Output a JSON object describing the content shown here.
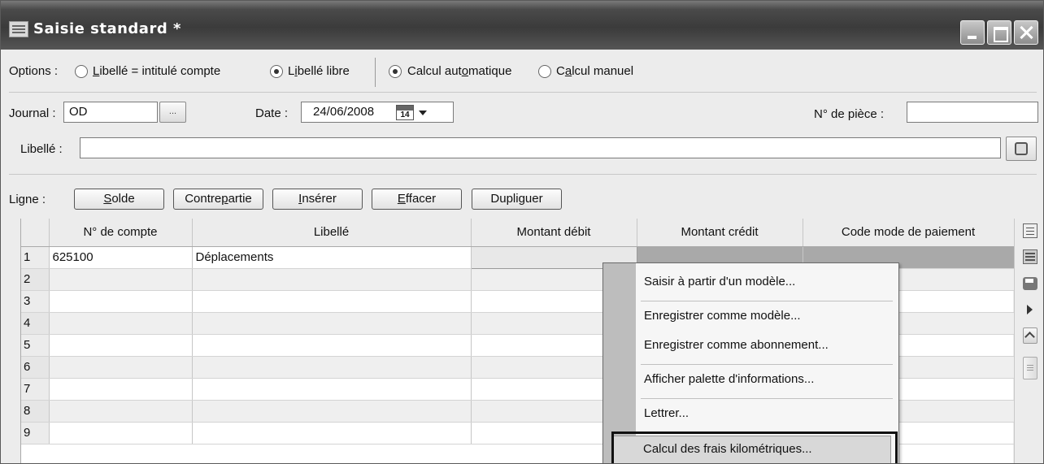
{
  "window": {
    "title": "Saisie standard *"
  },
  "options": {
    "label": "Options :",
    "libelle_intitule_pre": "",
    "libelle_intitule_u": "L",
    "libelle_intitule_post": "ibellé = intitulé compte",
    "libelle_libre_pre": "L",
    "libelle_libre_u": "i",
    "libelle_libre_post": "bellé libre",
    "calcul_auto_pre": "Calcul aut",
    "calcul_auto_u": "o",
    "calcul_auto_post": "matique",
    "calcul_manuel_pre": "C",
    "calcul_manuel_u": "a",
    "calcul_manuel_post": "lcul manuel",
    "selected_libelle": "libre",
    "selected_calcul": "automatique"
  },
  "header": {
    "journal_label": "Journal :",
    "journal_value": "OD",
    "ellipsis": "...",
    "date_label": "Date :",
    "date_value": "24/06/2008",
    "calendar_day": "14",
    "piece_label": "N° de pièce :",
    "piece_value": "",
    "libelle_label": "Libellé :",
    "libelle_value": ""
  },
  "line_bar": {
    "label": "Ligne :",
    "buttons": [
      {
        "pre": "",
        "u": "S",
        "post": "olde"
      },
      {
        "pre": "Contre",
        "u": "p",
        "post": "artie"
      },
      {
        "pre": "",
        "u": "I",
        "post": "nsérer"
      },
      {
        "pre": "",
        "u": "E",
        "post": "ffacer"
      },
      {
        "pre": "Dupli",
        "u": "g",
        "post": "uer"
      }
    ]
  },
  "grid": {
    "columns": [
      "",
      "N° de compte",
      "Libellé",
      "Montant débit",
      "Montant crédit",
      "Code mode de paiement"
    ],
    "rows": [
      {
        "num": "1",
        "compte": "625100",
        "libelle": "Déplacements",
        "debit": "",
        "credit": "",
        "code": ""
      },
      {
        "num": "2",
        "compte": "",
        "libelle": "",
        "debit": "",
        "credit": "",
        "code": ""
      },
      {
        "num": "3",
        "compte": "",
        "libelle": "",
        "debit": "",
        "credit": "",
        "code": ""
      },
      {
        "num": "4",
        "compte": "",
        "libelle": "",
        "debit": "",
        "credit": "",
        "code": ""
      },
      {
        "num": "5",
        "compte": "",
        "libelle": "",
        "debit": "",
        "credit": "",
        "code": ""
      },
      {
        "num": "6",
        "compte": "",
        "libelle": "",
        "debit": "",
        "credit": "",
        "code": ""
      },
      {
        "num": "7",
        "compte": "",
        "libelle": "",
        "debit": "",
        "credit": "",
        "code": ""
      },
      {
        "num": "8",
        "compte": "",
        "libelle": "",
        "debit": "",
        "credit": "",
        "code": ""
      },
      {
        "num": "9",
        "compte": "",
        "libelle": "",
        "debit": "",
        "credit": "",
        "code": ""
      }
    ]
  },
  "side_tools": [
    "sort-icon",
    "list-icon",
    "print-icon",
    "play-icon",
    "scroll-up-icon",
    "scroll-thumb"
  ],
  "context_menu": {
    "items": [
      "Saisir à partir d'un modèle...",
      "Enregistrer comme modèle...",
      "Enregistrer comme abonnement...",
      "Afficher palette d'informations...",
      "Lettrer...",
      "Calcul des frais kilométriques..."
    ],
    "highlighted_index": 5
  }
}
